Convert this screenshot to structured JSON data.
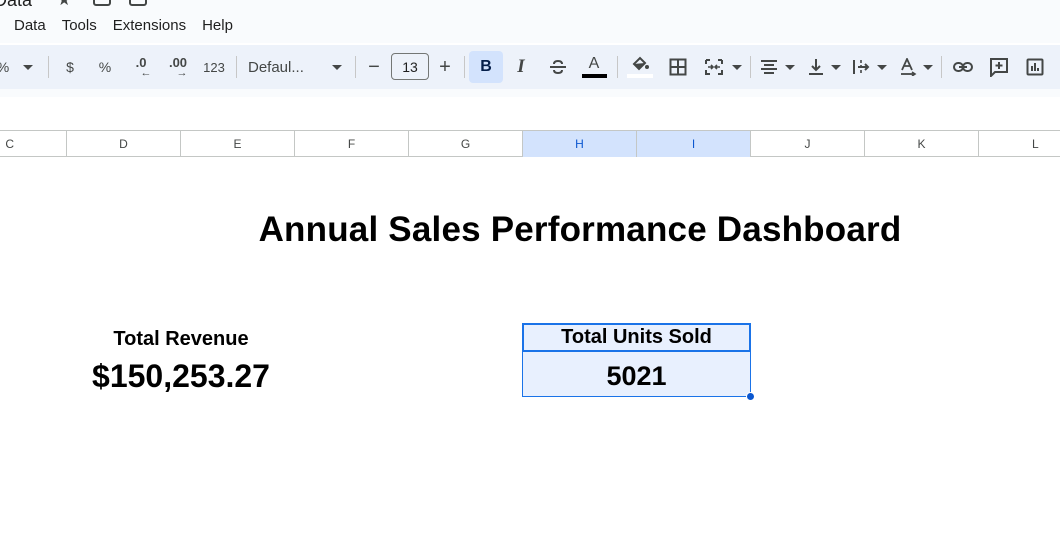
{
  "title_strip": {
    "doc_title_fragment": "Data"
  },
  "menu": {
    "items": [
      "Data",
      "Tools",
      "Extensions",
      "Help"
    ]
  },
  "toolbar": {
    "percent_partial": "%",
    "currency": "$",
    "percent": "%",
    "decrease_decimal": ".0",
    "increase_decimal": ".00",
    "more_formats": "123",
    "font_family": "Defaul...",
    "decrease_font": "−",
    "font_size": "13",
    "increase_font": "+",
    "bold": "B",
    "italic": "I",
    "text_color_letter": "A",
    "text_color": "#000000",
    "fill_color": "#ffffff"
  },
  "columns": [
    {
      "label": "C",
      "selected": false
    },
    {
      "label": "D",
      "selected": false
    },
    {
      "label": "E",
      "selected": false
    },
    {
      "label": "F",
      "selected": false
    },
    {
      "label": "G",
      "selected": false
    },
    {
      "label": "H",
      "selected": true
    },
    {
      "label": "I",
      "selected": true
    },
    {
      "label": "J",
      "selected": false
    },
    {
      "label": "K",
      "selected": false
    },
    {
      "label": "L",
      "selected": false
    }
  ],
  "sheet": {
    "dashboard_title": "Annual Sales Performance Dashboard",
    "total_revenue_label": "Total Revenue",
    "total_revenue_value": "$150,253.27",
    "total_units_label": "Total Units Sold",
    "total_units_value": "5021"
  },
  "colors": {
    "selection_border": "#1a73e8",
    "selection_fill": "#e8f0fe",
    "header_selected": "#d3e3fd",
    "toolbar_bg": "#edf2fa"
  }
}
